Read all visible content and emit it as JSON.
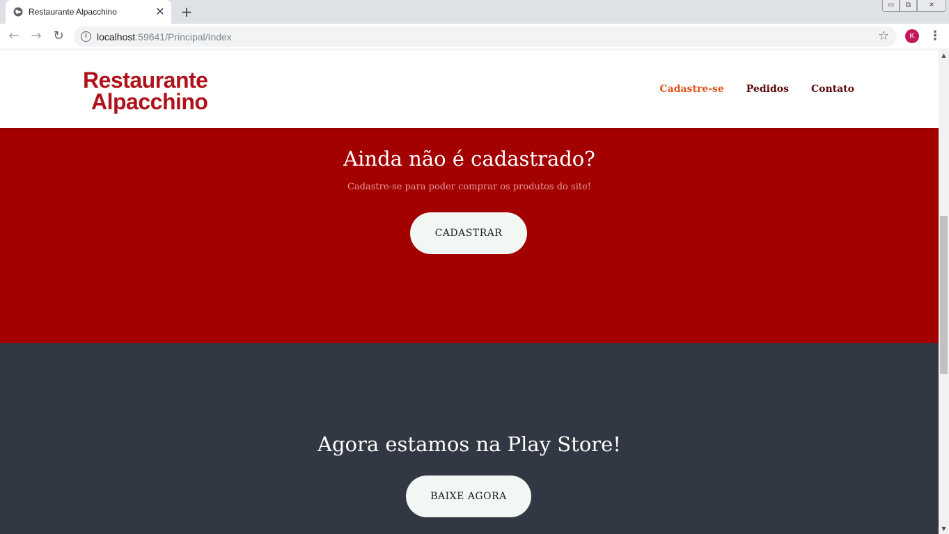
{
  "browser": {
    "tab_title": "Restaurante Alpacchino",
    "tab_close": "✕",
    "new_tab": "+",
    "url_host": "localhost",
    "url_path": ":59641/Principal/Index",
    "profile_initial": "K",
    "window_controls": {
      "minimize": "▭",
      "maximize": "⧉",
      "close": "✕"
    }
  },
  "header": {
    "logo_line1": "Restaurante",
    "logo_line2": "Alpacchino",
    "nav": [
      {
        "label": "Cadastre-se",
        "active": true
      },
      {
        "label": "Pedidos",
        "active": false
      },
      {
        "label": "Contato",
        "active": false
      }
    ]
  },
  "signup": {
    "title": "Ainda não é cadastrado?",
    "subtitle": "Cadastre-se para poder comprar os produtos do site!",
    "button": "CADASTRAR"
  },
  "app": {
    "title": "Agora estamos na Play Store!",
    "button": "BAIXE AGORA"
  },
  "colors": {
    "brand_red": "#b0121b",
    "section_red": "#a30000",
    "section_dark": "#323843",
    "nav_active": "#e0541e"
  }
}
